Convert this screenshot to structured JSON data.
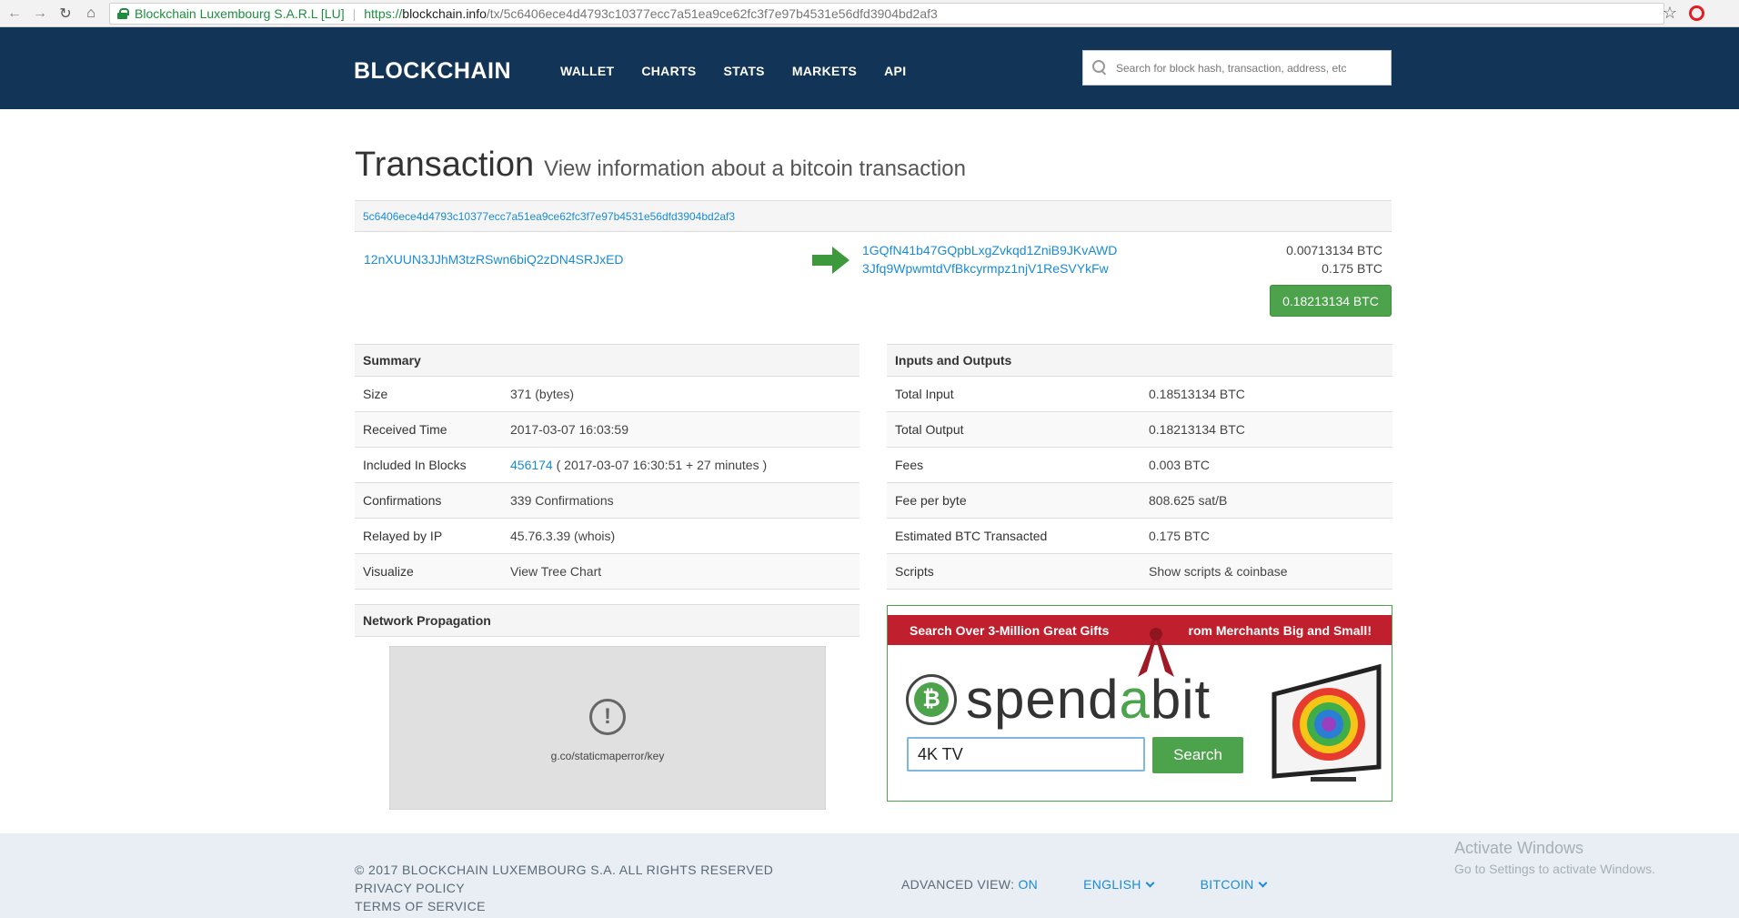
{
  "browser": {
    "site_identity": "Blockchain Luxembourg S.A.R.L [LU]",
    "url_scheme": "https://",
    "url_host": "blockchain.info",
    "url_path": "/tx/5c6406ece4d4793c10377ecc7a51ea9ce62fc3f7e97b4531e56dfd3904bd2af3"
  },
  "header": {
    "logo": "BLOCKCHAIN",
    "menu": [
      "WALLET",
      "CHARTS",
      "STATS",
      "MARKETS",
      "API"
    ],
    "search_placeholder": "Search for block hash, transaction, address, etc"
  },
  "page": {
    "title": "Transaction",
    "subtitle": "View information about a bitcoin transaction"
  },
  "tx": {
    "hash": "5c6406ece4d4793c10377ecc7a51ea9ce62fc3f7e97b4531e56dfd3904bd2af3",
    "input_address": "12nXUUN3JJhM3tzRSwn6biQ2zDN4SRJxED",
    "outputs": [
      {
        "address": "1GQfN41b47GQpbLxgZvkqd1ZniB9JKvAWD",
        "amount": "0.00713134 BTC"
      },
      {
        "address": "3Jfq9WpwmtdVfBkcyrmpz1njV1ReSVYkFw",
        "amount": "0.175 BTC"
      }
    ],
    "total": "0.18213134 BTC"
  },
  "summary": {
    "heading": "Summary",
    "rows": [
      {
        "label": "Size",
        "value": "371 (bytes)"
      },
      {
        "label": "Received Time",
        "value": "2017-03-07 16:03:59"
      },
      {
        "label": "Included In Blocks",
        "link": "456174",
        "value": " ( 2017-03-07 16:30:51 + 27 minutes )"
      },
      {
        "label": "Confirmations",
        "value": "339 Confirmations"
      },
      {
        "label": "Relayed by IP",
        "link": "45.76.3.39 (whois)"
      },
      {
        "label": "Visualize",
        "link": "View Tree Chart"
      }
    ]
  },
  "io": {
    "heading": "Inputs and Outputs",
    "rows": [
      {
        "label": "Total Input",
        "value": "0.18513134 BTC"
      },
      {
        "label": "Total Output",
        "value": "0.18213134 BTC"
      },
      {
        "label": "Fees",
        "value": "0.003 BTC"
      },
      {
        "label": "Fee per byte",
        "value": "808.625 sat/B"
      },
      {
        "label": "Estimated BTC Transacted",
        "value": "0.175 BTC"
      },
      {
        "label": "Scripts",
        "link": "Show scripts & coinbase"
      }
    ]
  },
  "network": {
    "heading": "Network Propagation",
    "map_error": "g.co/staticmaperror/key"
  },
  "ad": {
    "band_left": "Search Over 3-Million Great Gifts",
    "band_right": "From Merchants Big and Small!",
    "word_pre": "spend",
    "word_accent": "a",
    "word_post": "bit",
    "input_value": "4K TV",
    "button": "Search"
  },
  "footer": {
    "copyright": "© 2017 BLOCKCHAIN LUXEMBOURG S.A. ALL RIGHTS RESERVED",
    "privacy": "PRIVACY POLICY",
    "terms": "TERMS OF SERVICE",
    "advanced_label": "ADVANCED VIEW:",
    "advanced_value": "ON",
    "language": "ENGLISH",
    "currency": "BITCOIN"
  },
  "watermark": {
    "title": "Activate Windows",
    "sub": "Go to Settings to activate Windows."
  },
  "colors": {
    "header_bg": "#123456",
    "link": "#1a8bd6",
    "green": "#4ca34c",
    "ad_red": "#c0202d"
  }
}
